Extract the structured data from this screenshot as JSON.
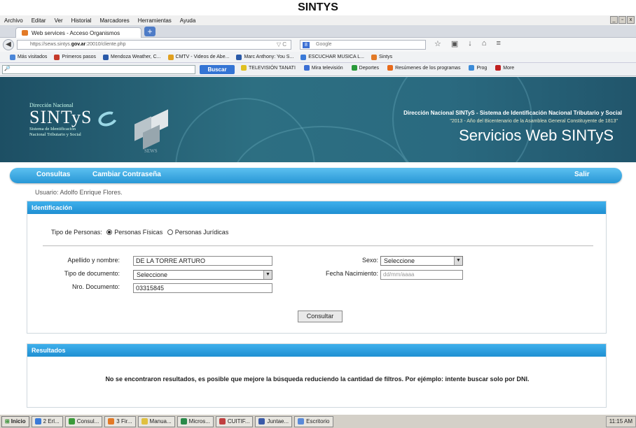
{
  "doc_title": "SINTYS",
  "menu": [
    "Archivo",
    "Editar",
    "Ver",
    "Historial",
    "Marcadores",
    "Herramientas",
    "Ayuda"
  ],
  "window_controls": [
    "_",
    "▫",
    "x"
  ],
  "tab": {
    "title": "Web services - Acceso Organismos",
    "new_tab": "+"
  },
  "address": {
    "prefix": "https://sews.sintys.",
    "domain": "gov.ar",
    "suffix": ":20010/cliente.php"
  },
  "google": {
    "badge": "8",
    "placeholder": "Google"
  },
  "bookmarks": [
    {
      "label": "Más visitados",
      "color": "#4a86d8"
    },
    {
      "label": "Primeros pasos",
      "color": "#c53a2a"
    },
    {
      "label": "Mendoza Weather, C...",
      "color": "#2a5aa8"
    },
    {
      "label": "CMTV - Videos de Abe...",
      "color": "#e0a020"
    },
    {
      "label": "Marc Anthony: You S...",
      "color": "#2a5aa8"
    },
    {
      "label": "ESCUCHAR MUSICA L...",
      "color": "#3a7ad8"
    },
    {
      "label": "Sintys",
      "color": "#e27a27"
    }
  ],
  "toolbar2": {
    "search_icon": "🔎",
    "buscar": "Buscar",
    "items": [
      {
        "label": "TELEVISIÓN TANATI",
        "color": "#e0c020"
      },
      {
        "label": "Mira televisión",
        "color": "#3b6fd4"
      },
      {
        "label": "Deportes",
        "color": "#2a9a3a"
      },
      {
        "label": "Resúmenes de los programas",
        "color": "#e86a1a"
      },
      {
        "label": "Prog",
        "color": "#3b8bd8"
      },
      {
        "label": "More",
        "color": "#c02020"
      }
    ]
  },
  "banner": {
    "dir_nacional": "Dirección Nacional",
    "logo": "SINTyS",
    "logo_sub1": "Sistema de Identificación",
    "logo_sub2": "Nacional Tributario y Social",
    "cube_label": "SEWS",
    "line1": "Dirección Nacional SINTyS - Sistema de Identificación Nacional Tributario y Social",
    "line2": "\"2013 - Año del Bicentenario de la Asamblea General Constituyente de 1813\"",
    "line3": "Servicios Web SINTyS"
  },
  "nav": {
    "consultas": "Consultas",
    "cambiar": "Cambiar Contraseña",
    "salir": "Salir"
  },
  "usuario": "Usuario: Adolfo Enrique Flores.",
  "identificacion": {
    "title": "Identificación",
    "tipo_personas_label": "Tipo de Personas:",
    "fisicas": "Personas Físicas",
    "juridicas": "Personas Jurídicas",
    "apellido_label": "Apellido y nombre:",
    "apellido_value": "DE LA TORRE ARTURO",
    "tipo_doc_label": "Tipo de documento:",
    "tipo_doc_value": "Seleccione",
    "nro_doc_label": "Nro. Documento:",
    "nro_doc_value": "03315845",
    "sexo_label": "Sexo:",
    "sexo_value": "Seleccione",
    "fecha_label": "Fecha Nacimiento:",
    "fecha_placeholder": "dd/mm/aaaa",
    "consultar": "Consultar"
  },
  "resultados": {
    "title": "Resultados",
    "message": "No se encontraron resultados, es posible que mejore la búsqueda reduciendo la cantidad de filtros. Por ejémplo: intente buscar solo por DNI."
  },
  "taskbar": {
    "start": "Inicio",
    "buttons": [
      {
        "label": "2 Erl...",
        "color": "#3a7ad8"
      },
      {
        "label": "Consul...",
        "color": "#3a9a3a"
      },
      {
        "label": "3 Fir...",
        "color": "#e27a27"
      },
      {
        "label": "Manua...",
        "color": "#e0c040"
      },
      {
        "label": "Micros...",
        "color": "#2a8a4a"
      },
      {
        "label": "CUITIF...",
        "color": "#c04040"
      },
      {
        "label": "Juntae...",
        "color": "#3a5aa8"
      },
      {
        "label": "Escritorio",
        "color": "#5a8ad8"
      }
    ],
    "clock": "11:15 AM"
  }
}
